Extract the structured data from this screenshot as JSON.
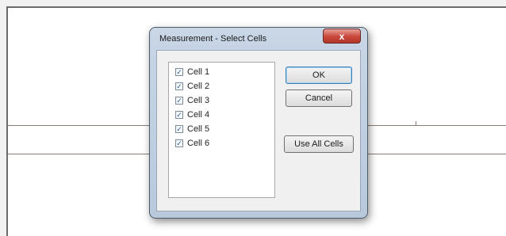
{
  "dialog": {
    "title": "Measurement - Select Cells",
    "close_label": "x"
  },
  "cells": [
    {
      "label": "Cell 1",
      "checked": true
    },
    {
      "label": "Cell 2",
      "checked": true
    },
    {
      "label": "Cell 3",
      "checked": true
    },
    {
      "label": "Cell 4",
      "checked": true
    },
    {
      "label": "Cell 5",
      "checked": true
    },
    {
      "label": "Cell 6",
      "checked": true
    }
  ],
  "buttons": {
    "ok": "OK",
    "cancel": "Cancel",
    "use_all": "Use All Cells"
  },
  "checkmark": "✓"
}
